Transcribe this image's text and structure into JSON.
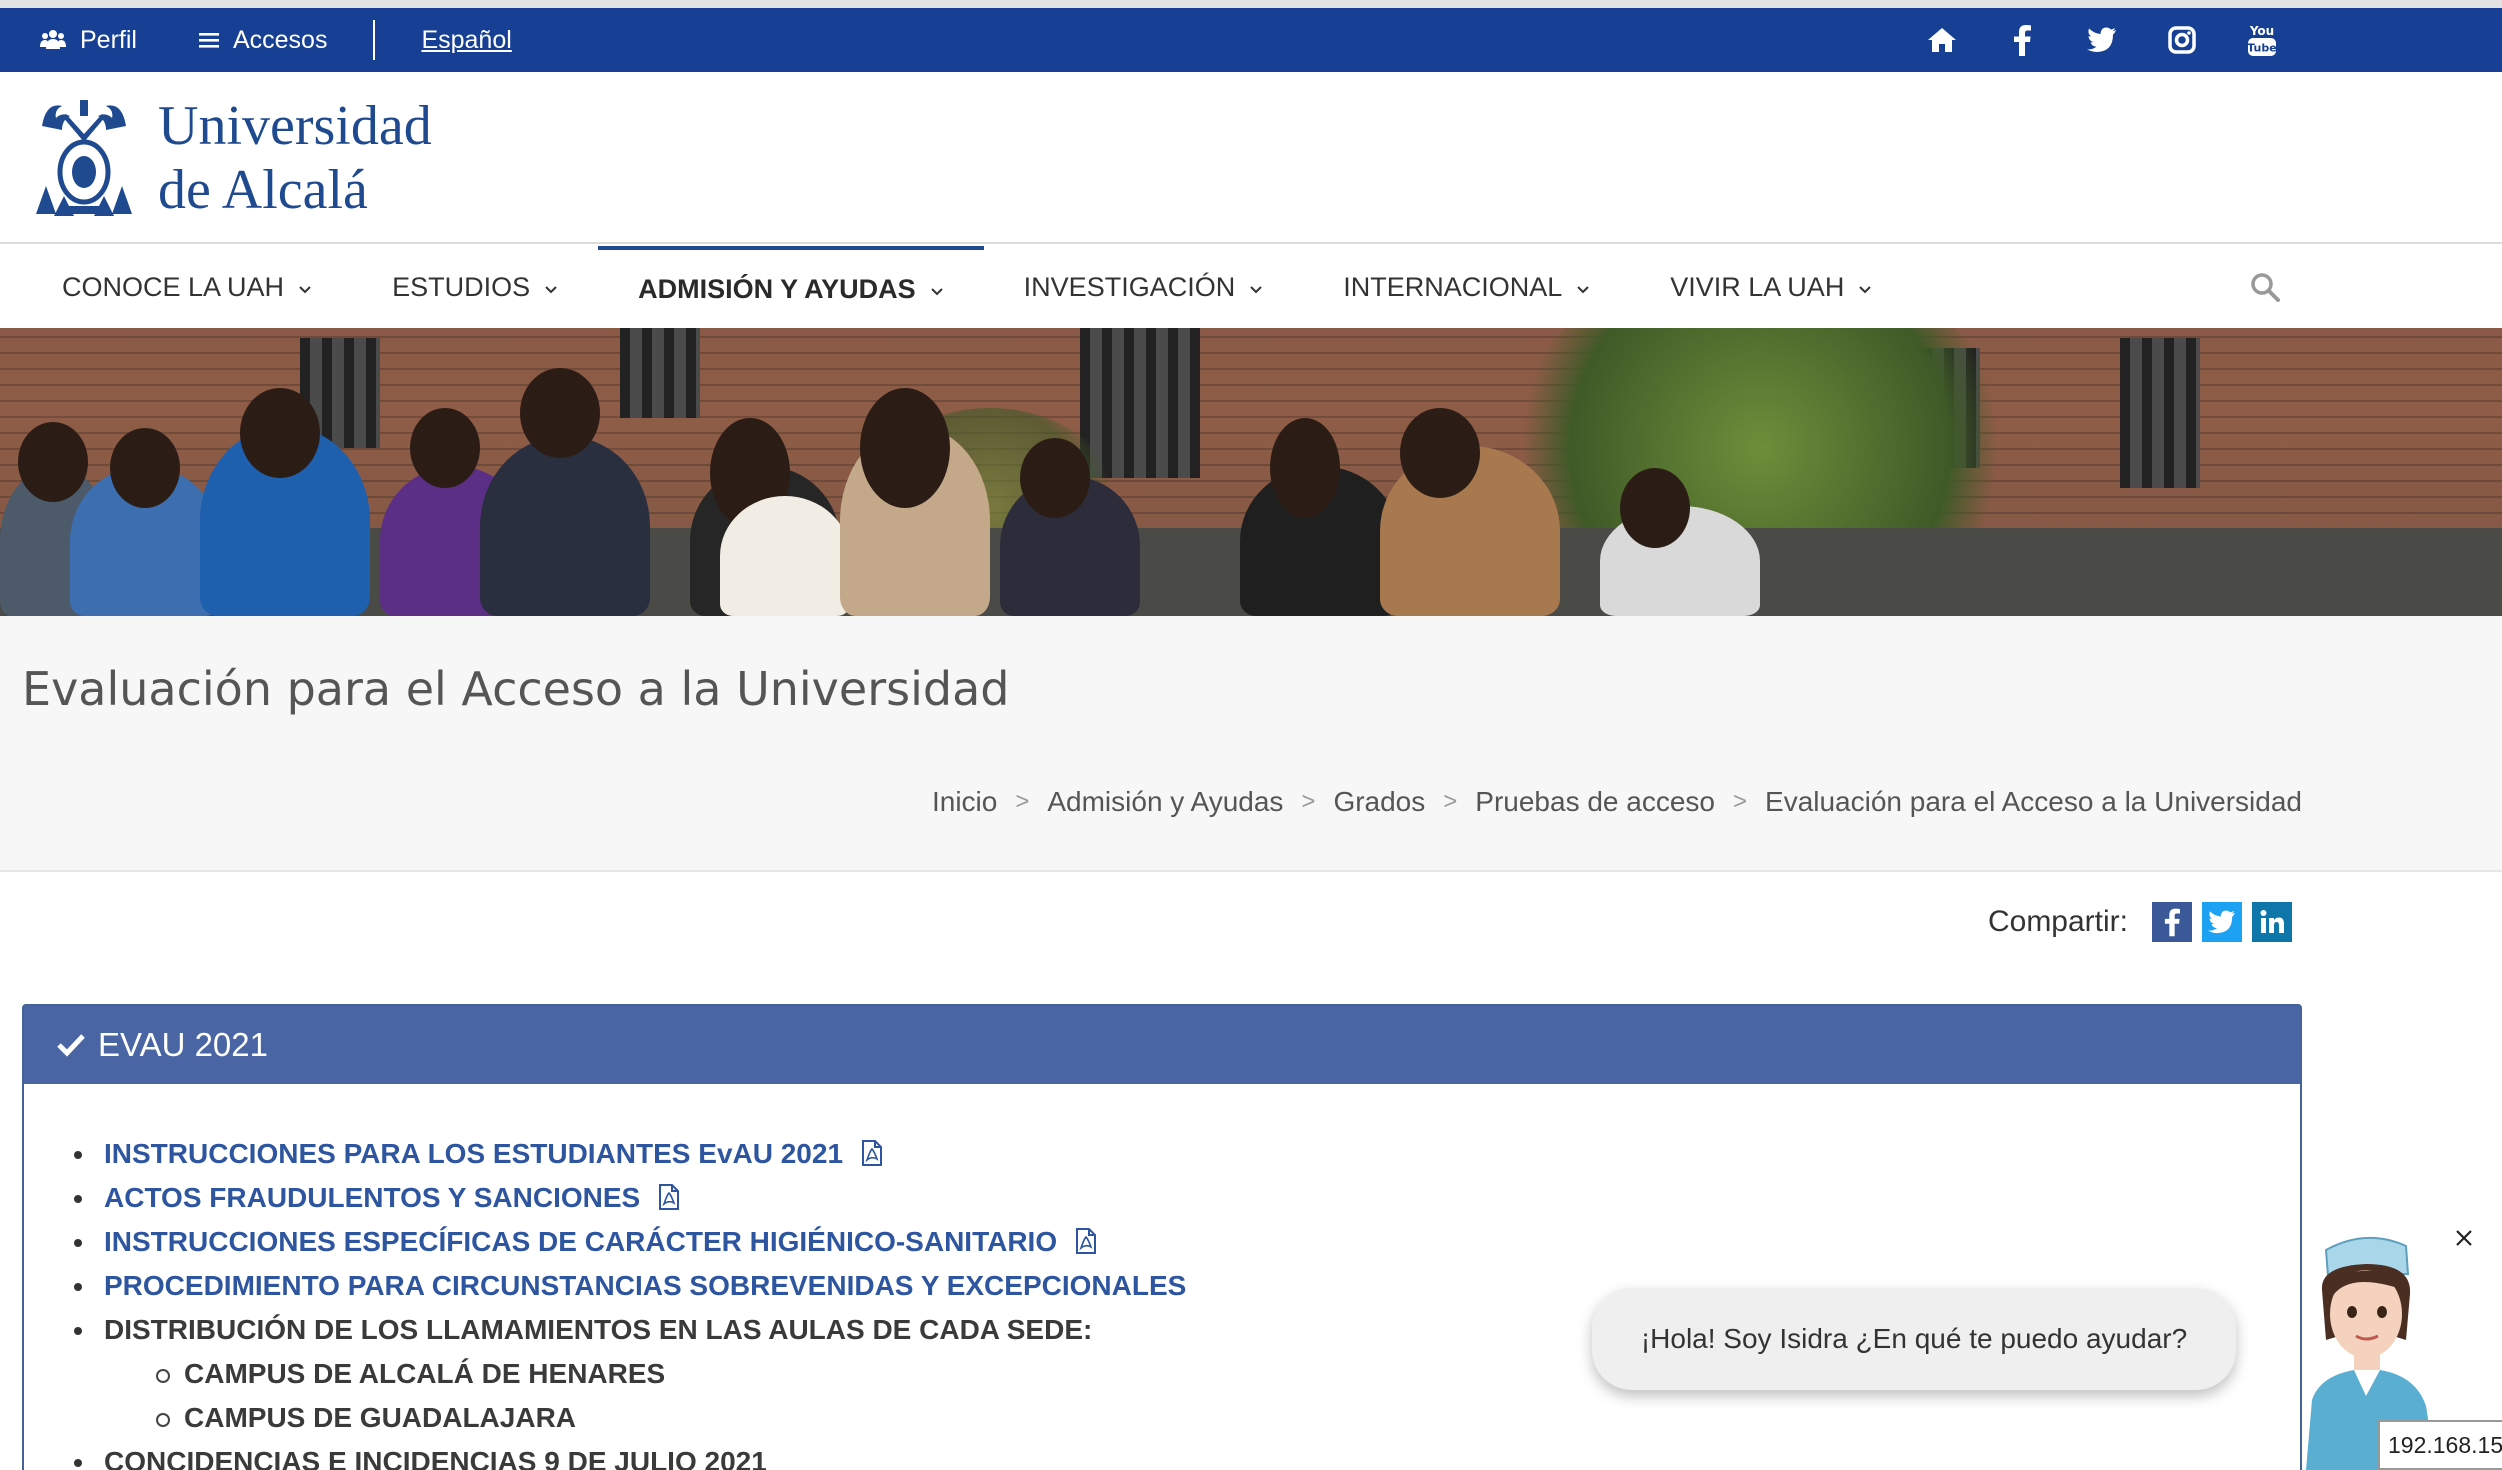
{
  "topbar": {
    "profile_label": "Perfil",
    "access_label": "Accesos",
    "language_label": "Español",
    "social": [
      "home-icon",
      "facebook-icon",
      "twitter-icon",
      "instagram-icon",
      "youtube-icon"
    ],
    "color": "#173f94"
  },
  "header": {
    "logo_line1": "Universidad",
    "logo_line2": "de Alcalá"
  },
  "nav": {
    "items": [
      {
        "label": "CONOCE LA UAH"
      },
      {
        "label": "ESTUDIOS"
      },
      {
        "label": "ADMISIÓN Y AYUDAS"
      },
      {
        "label": "INVESTIGACIÓN"
      },
      {
        "label": "INTERNACIONAL"
      },
      {
        "label": "VIVIR LA UAH"
      }
    ],
    "active": "ADMISIÓN Y AYUDAS"
  },
  "page": {
    "title": "Evaluación para el Acceso a la Universidad"
  },
  "breadcrumb": {
    "items": [
      "Inicio",
      "Admisión y Ayudas",
      "Grados",
      "Pruebas de acceso",
      "Evaluación para el Acceso a la Universidad"
    ],
    "separator": ">"
  },
  "share": {
    "label": "Compartir:",
    "buttons": [
      "facebook-icon",
      "twitter-icon",
      "linkedin-icon"
    ]
  },
  "panel": {
    "title": "EVAU 2021",
    "header_color": "#4a65a3",
    "items": [
      {
        "label": "INSTRUCCIONES PARA LOS ESTUDIANTES EvAU 2021",
        "pdf": true
      },
      {
        "label": "ACTOS FRAUDULENTOS Y SANCIONES",
        "pdf": true
      },
      {
        "label": "INSTRUCCIONES ESPECÍFICAS DE CARÁCTER HIGIÉNICO-SANITARIO",
        "pdf": true
      },
      {
        "label": "PROCEDIMIENTO PARA CIRCUNSTANCIAS SOBREVENIDAS Y EXCEPCIONALES",
        "pdf": false
      },
      {
        "label": "DISTRIBUCIÓN DE LOS LLAMAMIENTOS EN LAS AULAS DE CADA SEDE:",
        "pdf": false
      },
      {
        "label": "CONCIDENCIAS E INCIDENCIAS 9 DE JULIO 2021",
        "pdf": false
      }
    ],
    "subitems": [
      "CAMPUS DE ALCALÁ DE HENARES",
      "CAMPUS DE GUADALAJARA"
    ]
  },
  "chat": {
    "greeting": "¡Hola! Soy Isidra ¿En qué te puedo ayudar?"
  },
  "status": {
    "ip": "192.168.15"
  }
}
